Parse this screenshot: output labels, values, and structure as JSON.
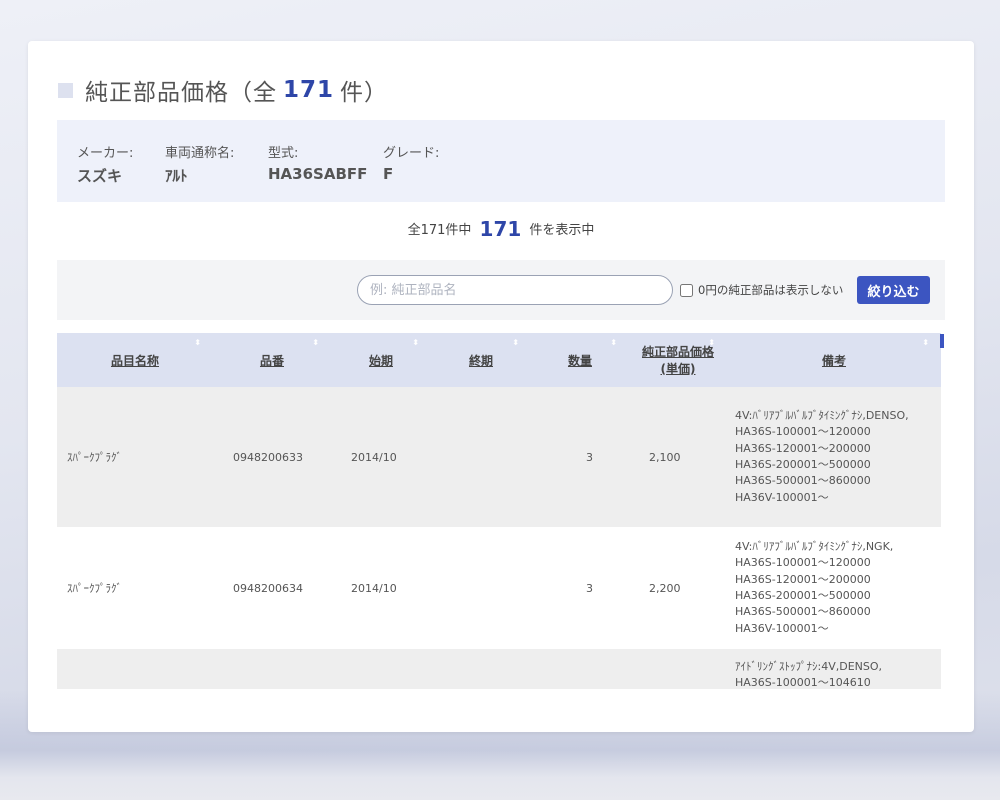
{
  "page": {
    "title_prefix": "純正部品価格（全",
    "title_count": "171",
    "title_suffix": "件）"
  },
  "vehicle": {
    "maker_label": "メーカー:",
    "maker_value": "スズキ",
    "model_label": "車両通称名:",
    "model_value": "ｱﾙﾄ",
    "type_label": "型式:",
    "type_value": "HA36SABFF",
    "grade_label": "グレード:",
    "grade_value": "F"
  },
  "summary": {
    "prefix": "全171件中",
    "count": "171",
    "suffix": "件を表示中"
  },
  "filter": {
    "search_placeholder": "例: 純正部品名",
    "hide_zero_label": "0円の純正部品は表示しない",
    "button_label": "絞り込む"
  },
  "table": {
    "headers": {
      "name": "品目名称",
      "part_no": "品番",
      "start": "始期",
      "end": "終期",
      "qty": "数量",
      "price_line1": "純正部品価格",
      "price_line2": "(単価)",
      "notes": "備考"
    },
    "rows": [
      {
        "name": "ｽﾊﾟｰｸﾌﾟﾗｸﾞ",
        "part_no": "0948200633",
        "start": "2014/10",
        "end": "",
        "qty": "3",
        "price": "2,100",
        "notes": [
          "4V:ﾊﾞﾘｱﾌﾞﾙﾊﾞﾙﾌﾞﾀｲﾐﾝｸﾞﾅｼ,DENSO,",
          "HA36S-100001～120000",
          "HA36S-120001～200000",
          "HA36S-200001～500000",
          "HA36S-500001～860000",
          "HA36V-100001～"
        ]
      },
      {
        "name": "ｽﾊﾟｰｸﾌﾟﾗｸﾞ",
        "part_no": "0948200634",
        "start": "2014/10",
        "end": "",
        "qty": "3",
        "price": "2,200",
        "notes": [
          "4V:ﾊﾞﾘｱﾌﾞﾙﾊﾞﾙﾌﾞﾀｲﾐﾝｸﾞﾅｼ,NGK,",
          "HA36S-100001～120000",
          "HA36S-120001～200000",
          "HA36S-200001～500000",
          "HA36S-500001～860000",
          "HA36V-100001～"
        ]
      },
      {
        "name": "",
        "part_no": "",
        "start": "",
        "end": "",
        "qty": "",
        "price": "",
        "notes": [
          "ｱｲﾄﾞﾘﾝｸﾞｽﾄｯﾌﾟﾅｼ:4V,DENSO,",
          "HA36S-100001～104610"
        ]
      }
    ]
  },
  "colors": {
    "accent": "#3c55c1",
    "count_text": "#2e46a8",
    "header_bg": "#dce1f1",
    "info_bg": "#eef1fa"
  }
}
